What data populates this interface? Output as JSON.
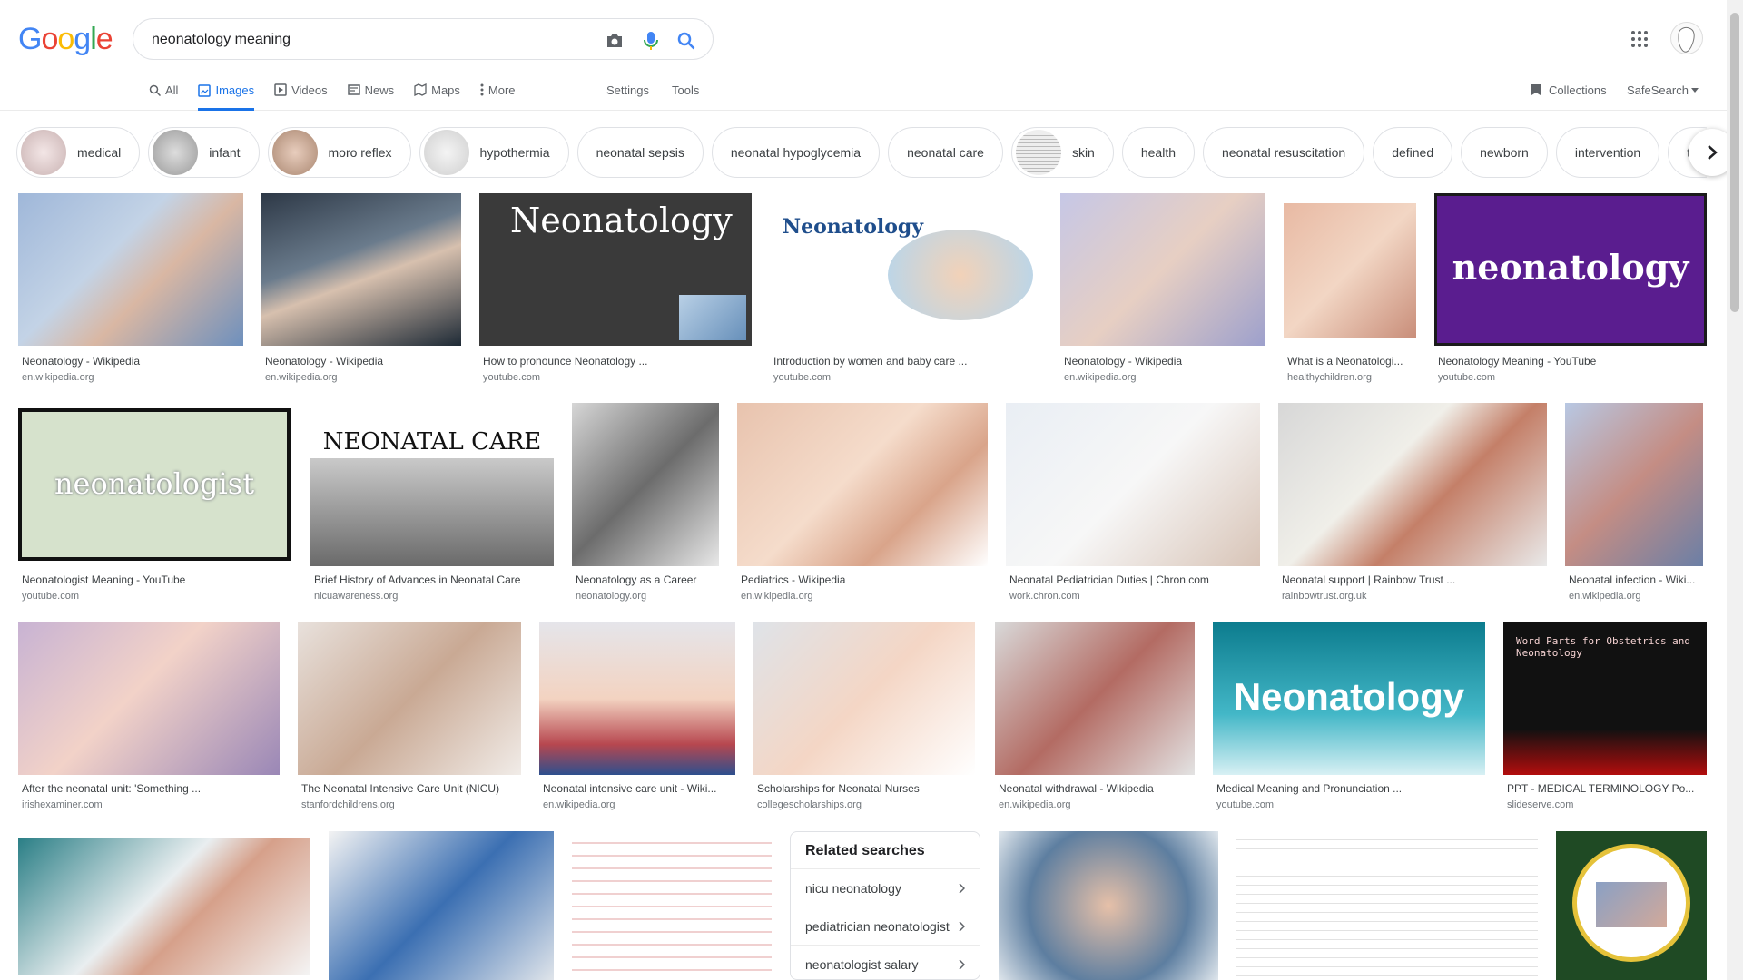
{
  "header": {
    "logo": "Google",
    "query": "neonatology meaning"
  },
  "nav": {
    "tabs": [
      {
        "label": "All",
        "icon": "search-icon"
      },
      {
        "label": "Images",
        "icon": "image-icon"
      },
      {
        "label": "Videos",
        "icon": "play-icon"
      },
      {
        "label": "News",
        "icon": "newspaper-icon"
      },
      {
        "label": "Maps",
        "icon": "map-icon"
      },
      {
        "label": "More",
        "icon": "dots-icon"
      }
    ],
    "settings": "Settings",
    "tools": "Tools",
    "collections": "Collections",
    "safesearch": "SafeSearch"
  },
  "chips": [
    "medical",
    "infant",
    "moro reflex",
    "hypothermia",
    "neonatal sepsis",
    "neonatal hypoglycemia",
    "neonatal care",
    "skin",
    "health",
    "neonatal resuscitation",
    "defined",
    "newborn",
    "intervention",
    "tran"
  ],
  "results": [
    {
      "title": "Neonatology - Wikipedia",
      "source": "en.wikipedia.org",
      "overlay": ""
    },
    {
      "title": "Neonatology - Wikipedia",
      "source": "en.wikipedia.org",
      "overlay": ""
    },
    {
      "title": "How to pronounce Neonatology ...",
      "source": "youtube.com",
      "overlay": "Neonatology"
    },
    {
      "title": "Introduction by women and baby care ...",
      "source": "youtube.com",
      "overlay": "Neonatology"
    },
    {
      "title": "Neonatology - Wikipedia",
      "source": "en.wikipedia.org",
      "overlay": ""
    },
    {
      "title": "What is a Neonatologi...",
      "source": "healthychildren.org",
      "overlay": ""
    },
    {
      "title": "Neonatology Meaning - YouTube",
      "source": "youtube.com",
      "overlay": "neonatology"
    },
    {
      "title": "Neonatologist Meaning - YouTube",
      "source": "youtube.com",
      "overlay": "neonatologist"
    },
    {
      "title": "Brief History of Advances in Neonatal Care",
      "source": "nicuawareness.org",
      "overlay": "NEONATAL CARE"
    },
    {
      "title": "Neonatology as a Career",
      "source": "neonatology.org",
      "overlay": ""
    },
    {
      "title": "Pediatrics - Wikipedia",
      "source": "en.wikipedia.org",
      "overlay": ""
    },
    {
      "title": "Neonatal Pediatrician Duties | Chron.com",
      "source": "work.chron.com",
      "overlay": ""
    },
    {
      "title": "Neonatal support | Rainbow Trust ...",
      "source": "rainbowtrust.org.uk",
      "overlay": ""
    },
    {
      "title": "Neonatal infection - Wiki...",
      "source": "en.wikipedia.org",
      "overlay": ""
    },
    {
      "title": "After the neonatal unit: 'Something ...",
      "source": "irishexaminer.com",
      "overlay": ""
    },
    {
      "title": "The Neonatal Intensive Care Unit (NICU)",
      "source": "stanfordchildrens.org",
      "overlay": ""
    },
    {
      "title": "Neonatal intensive care unit - Wiki...",
      "source": "en.wikipedia.org",
      "overlay": ""
    },
    {
      "title": "Scholarships for Neonatal Nurses",
      "source": "collegescholarships.org",
      "overlay": ""
    },
    {
      "title": "Neonatal withdrawal - Wikipedia",
      "source": "en.wikipedia.org",
      "overlay": ""
    },
    {
      "title": "Medical Meaning and Pronunciation ...",
      "source": "youtube.com",
      "overlay": "Neonatology"
    },
    {
      "title": "PPT - MEDICAL TERMINOLOGY Po...",
      "source": "slideserve.com",
      "overlay": "Word Parts for Obstetrics and Neonatology"
    }
  ],
  "related": {
    "heading": "Related searches",
    "items": [
      "nicu neonatology",
      "pediatrician neonatologist",
      "neonatologist salary"
    ]
  }
}
